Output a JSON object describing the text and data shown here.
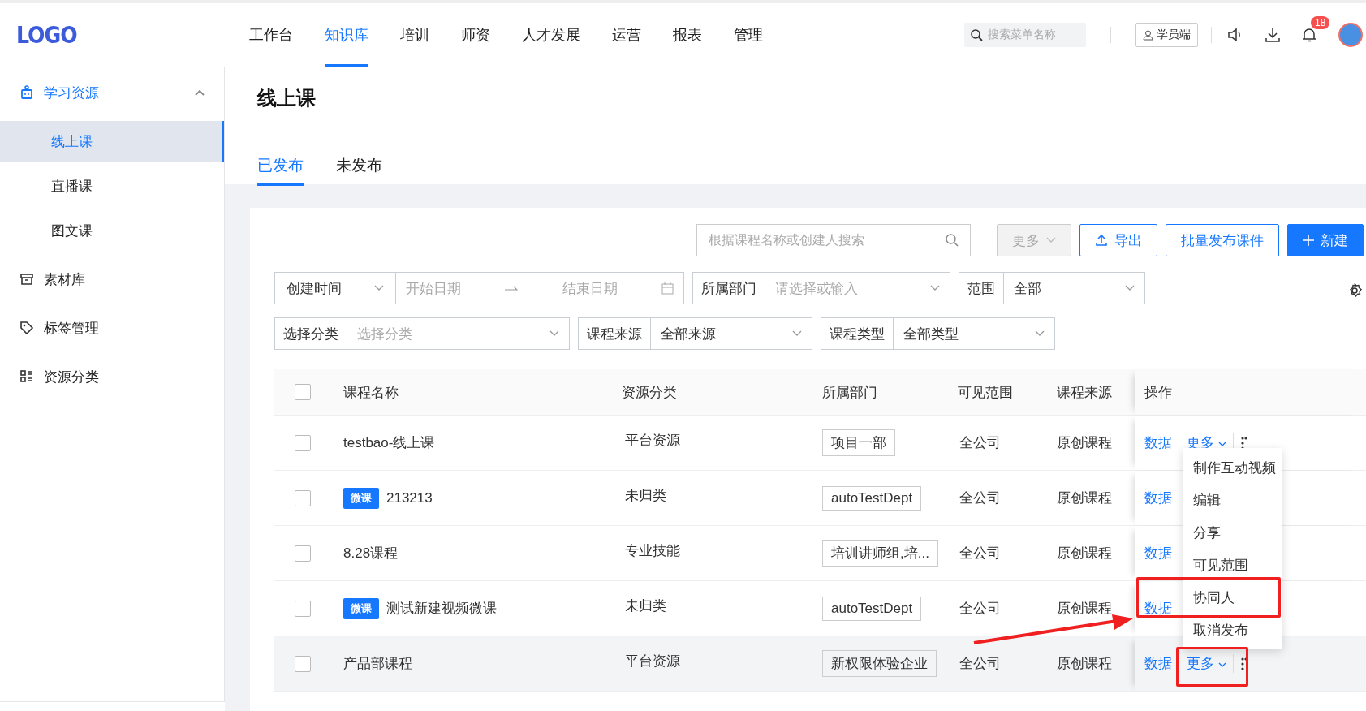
{
  "header": {
    "logo": "LOGO",
    "nav": [
      {
        "label": "工作台",
        "selected": false
      },
      {
        "label": "知识库",
        "selected": true
      },
      {
        "label": "培训",
        "selected": false
      },
      {
        "label": "师资",
        "selected": false
      },
      {
        "label": "人才发展",
        "selected": false
      },
      {
        "label": "运营",
        "selected": false
      },
      {
        "label": "报表",
        "selected": false
      },
      {
        "label": "管理",
        "selected": false
      }
    ],
    "search": {
      "placeholder": "搜索菜单名称"
    },
    "student_button": "学员端",
    "notification_count": "18"
  },
  "sidebar": {
    "items": [
      {
        "label": "学习资源",
        "kind": "group",
        "expanded": true,
        "children": [
          {
            "label": "线上课",
            "selected": true
          },
          {
            "label": "直播课",
            "selected": false
          },
          {
            "label": "图文课",
            "selected": false
          }
        ]
      },
      {
        "label": "素材库",
        "kind": "item",
        "selected": false
      },
      {
        "label": "标签管理",
        "kind": "item",
        "selected": false
      },
      {
        "label": "资源分类",
        "kind": "item",
        "selected": false
      }
    ]
  },
  "page": {
    "title": "线上课",
    "tabs": [
      {
        "label": "已发布",
        "selected": true
      },
      {
        "label": "未发布",
        "selected": false
      }
    ]
  },
  "toolbar": {
    "search": {
      "placeholder": "根据课程名称或创建人搜索"
    },
    "buttons": [
      {
        "label": "更多",
        "kind": "dropdown",
        "disabled": true
      },
      {
        "label": "导出",
        "kind": "export",
        "disabled": false
      },
      {
        "label": "批量发布课件",
        "kind": "outline",
        "disabled": false
      },
      {
        "label": "新建",
        "kind": "primary",
        "disabled": false
      }
    ]
  },
  "filters": [
    [
      {
        "kind": "date_range",
        "label": "创建时间",
        "start_placeholder": "开始日期",
        "end_placeholder": "结束日期"
      },
      {
        "kind": "select",
        "label": "所属部门",
        "placeholder": "请选择或输入"
      },
      {
        "kind": "select",
        "label": "范围",
        "value": "全部"
      }
    ],
    [
      {
        "kind": "select",
        "label": "选择分类",
        "placeholder": "选择分类"
      },
      {
        "kind": "select",
        "label": "课程来源",
        "value": "全部来源"
      },
      {
        "kind": "select",
        "label": "课程类型",
        "value": "全部类型"
      }
    ]
  ],
  "table": {
    "header_checked": false,
    "columns": [
      "课程名称",
      "资源分类",
      "所属部门",
      "可见范围",
      "课程来源",
      "操作"
    ],
    "rows": [
      {
        "checked": false,
        "highlighted": false,
        "name": "testbao-线上课",
        "category": "平台资源",
        "department": "项目一部",
        "scope": "全公司",
        "source": "原创课程",
        "actions": [
          {
            "kind": "link",
            "label": "数据"
          },
          {
            "kind": "dropdown",
            "label": "更多"
          }
        ]
      },
      {
        "checked": false,
        "highlighted": false,
        "tag": "微课",
        "name": "213213",
        "category": "未归类",
        "department": "autoTestDept",
        "scope": "全公司",
        "source": "原创课程",
        "actions": [
          {
            "kind": "link",
            "label": "数据"
          }
        ]
      },
      {
        "checked": false,
        "highlighted": false,
        "name": "8.28课程",
        "category": "专业技能",
        "department": "培训讲师组,培...",
        "scope": "全公司",
        "source": "原创课程",
        "actions": [
          {
            "kind": "link",
            "label": "数据"
          }
        ]
      },
      {
        "checked": false,
        "highlighted": false,
        "tag": "微课",
        "name": "测试新建视频微课",
        "category": "未归类",
        "department": "autoTestDept",
        "scope": "全公司",
        "source": "原创课程",
        "actions": [
          {
            "kind": "link",
            "label": "数据"
          }
        ]
      },
      {
        "checked": false,
        "highlighted": true,
        "name": "产品部课程",
        "category": "平台资源",
        "department": "新权限体验企业",
        "scope": "全公司",
        "source": "原创课程",
        "actions": [
          {
            "kind": "link",
            "label": "数据"
          },
          {
            "kind": "dropdown",
            "label": "更多"
          }
        ]
      }
    ]
  },
  "dropdown_menu": {
    "items": [
      "制作互动视频",
      "编辑",
      "分享",
      "可见范围",
      "协同人",
      "取消发布"
    ]
  }
}
